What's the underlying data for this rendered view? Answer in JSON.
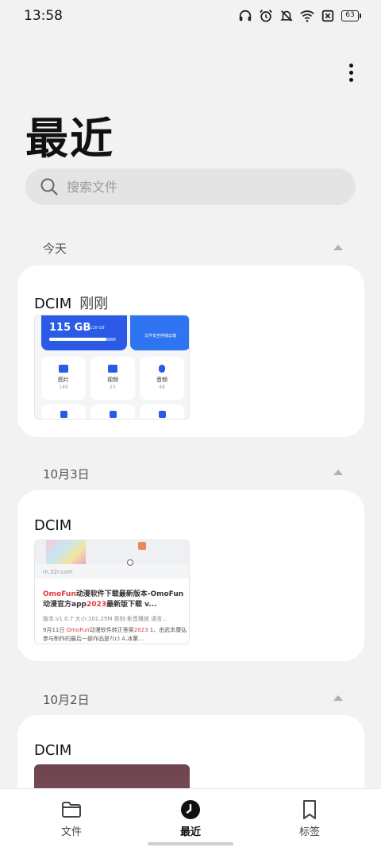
{
  "status": {
    "time": "13:58",
    "battery": "63"
  },
  "header": {
    "title": "最近"
  },
  "search": {
    "placeholder": "搜索文件"
  },
  "sections": [
    {
      "date": "今天",
      "folder": "DCIM",
      "time_label": "刚刚"
    },
    {
      "date": "10月3日",
      "folder": "DCIM"
    },
    {
      "date": "10月2日",
      "folder": "DCIM"
    }
  ],
  "thumb1": {
    "storage": "115 GB",
    "storage_total": "/ 128 GB",
    "banner": "文件安全存储云端",
    "tiles": [
      {
        "name": "图片",
        "count": "149"
      },
      {
        "name": "视频",
        "count": "23"
      },
      {
        "name": "音频",
        "count": "48"
      }
    ]
  },
  "thumb2": {
    "url": "m.32r.com",
    "title_a": "OmoFun",
    "title_b": "动漫软件下载最新版本-OmoFun动漫官方app",
    "title_c": "2023",
    "title_d": "最新版下载 v...",
    "meta": "版本:v1.0.7   大小:101.25M   类别:影音播放   语言...",
    "desc_a": "9月11日 ",
    "desc_b": "OmoFun",
    "desc_c": "动漫软件转正答案",
    "desc_d": "2023",
    "desc_e": " 1、由武本康弘参与制作的最后一部作品是?(c) A.冰菓..."
  },
  "nav": [
    {
      "label": "文件",
      "icon": "folder-icon"
    },
    {
      "label": "最近",
      "icon": "clock-icon"
    },
    {
      "label": "标签",
      "icon": "bookmark-icon"
    }
  ],
  "colors": {
    "accent_blue": "#2b5ae6",
    "highlight_red": "#e03b3b"
  }
}
